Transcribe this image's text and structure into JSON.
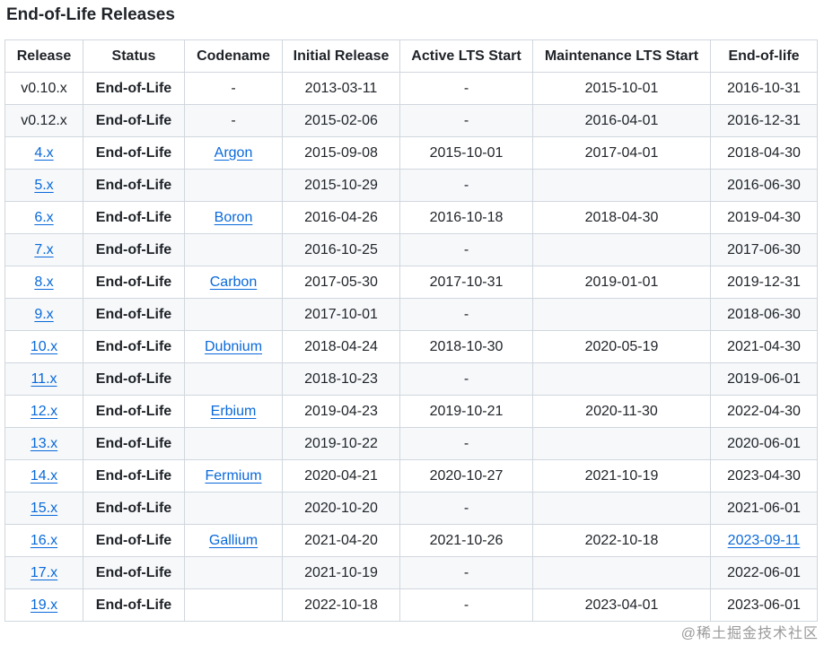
{
  "title": "End-of-Life Releases",
  "table": {
    "headers": [
      "Release",
      "Status",
      "Codename",
      "Initial Release",
      "Active LTS Start",
      "Maintenance LTS Start",
      "End-of-life"
    ],
    "rows": [
      {
        "release": "v0.10.x",
        "release_link": false,
        "status": "End-of-Life",
        "codename": "-",
        "codename_link": false,
        "initial": "2013-03-11",
        "active": "-",
        "maintenance": "2015-10-01",
        "eol": "2016-10-31",
        "eol_link": false
      },
      {
        "release": "v0.12.x",
        "release_link": false,
        "status": "End-of-Life",
        "codename": "-",
        "codename_link": false,
        "initial": "2015-02-06",
        "active": "-",
        "maintenance": "2016-04-01",
        "eol": "2016-12-31",
        "eol_link": false
      },
      {
        "release": "4.x",
        "release_link": true,
        "status": "End-of-Life",
        "codename": "Argon",
        "codename_link": true,
        "initial": "2015-09-08",
        "active": "2015-10-01",
        "maintenance": "2017-04-01",
        "eol": "2018-04-30",
        "eol_link": false
      },
      {
        "release": "5.x",
        "release_link": true,
        "status": "End-of-Life",
        "codename": "",
        "codename_link": false,
        "initial": "2015-10-29",
        "active": "-",
        "maintenance": "",
        "eol": "2016-06-30",
        "eol_link": false
      },
      {
        "release": "6.x",
        "release_link": true,
        "status": "End-of-Life",
        "codename": "Boron",
        "codename_link": true,
        "initial": "2016-04-26",
        "active": "2016-10-18",
        "maintenance": "2018-04-30",
        "eol": "2019-04-30",
        "eol_link": false
      },
      {
        "release": "7.x",
        "release_link": true,
        "status": "End-of-Life",
        "codename": "",
        "codename_link": false,
        "initial": "2016-10-25",
        "active": "-",
        "maintenance": "",
        "eol": "2017-06-30",
        "eol_link": false
      },
      {
        "release": "8.x",
        "release_link": true,
        "status": "End-of-Life",
        "codename": "Carbon",
        "codename_link": true,
        "initial": "2017-05-30",
        "active": "2017-10-31",
        "maintenance": "2019-01-01",
        "eol": "2019-12-31",
        "eol_link": false
      },
      {
        "release": "9.x",
        "release_link": true,
        "status": "End-of-Life",
        "codename": "",
        "codename_link": false,
        "initial": "2017-10-01",
        "active": "-",
        "maintenance": "",
        "eol": "2018-06-30",
        "eol_link": false
      },
      {
        "release": "10.x",
        "release_link": true,
        "status": "End-of-Life",
        "codename": "Dubnium",
        "codename_link": true,
        "initial": "2018-04-24",
        "active": "2018-10-30",
        "maintenance": "2020-05-19",
        "eol": "2021-04-30",
        "eol_link": false
      },
      {
        "release": "11.x",
        "release_link": true,
        "status": "End-of-Life",
        "codename": "",
        "codename_link": false,
        "initial": "2018-10-23",
        "active": "-",
        "maintenance": "",
        "eol": "2019-06-01",
        "eol_link": false
      },
      {
        "release": "12.x",
        "release_link": true,
        "status": "End-of-Life",
        "codename": "Erbium",
        "codename_link": true,
        "initial": "2019-04-23",
        "active": "2019-10-21",
        "maintenance": "2020-11-30",
        "eol": "2022-04-30",
        "eol_link": false
      },
      {
        "release": "13.x",
        "release_link": true,
        "status": "End-of-Life",
        "codename": "",
        "codename_link": false,
        "initial": "2019-10-22",
        "active": "-",
        "maintenance": "",
        "eol": "2020-06-01",
        "eol_link": false
      },
      {
        "release": "14.x",
        "release_link": true,
        "status": "End-of-Life",
        "codename": "Fermium",
        "codename_link": true,
        "initial": "2020-04-21",
        "active": "2020-10-27",
        "maintenance": "2021-10-19",
        "eol": "2023-04-30",
        "eol_link": false
      },
      {
        "release": "15.x",
        "release_link": true,
        "status": "End-of-Life",
        "codename": "",
        "codename_link": false,
        "initial": "2020-10-20",
        "active": "-",
        "maintenance": "",
        "eol": "2021-06-01",
        "eol_link": false
      },
      {
        "release": "16.x",
        "release_link": true,
        "status": "End-of-Life",
        "codename": "Gallium",
        "codename_link": true,
        "initial": "2021-04-20",
        "active": "2021-10-26",
        "maintenance": "2022-10-18",
        "eol": "2023-09-11",
        "eol_link": true
      },
      {
        "release": "17.x",
        "release_link": true,
        "status": "End-of-Life",
        "codename": "",
        "codename_link": false,
        "initial": "2021-10-19",
        "active": "-",
        "maintenance": "",
        "eol": "2022-06-01",
        "eol_link": false
      },
      {
        "release": "19.x",
        "release_link": true,
        "status": "End-of-Life",
        "codename": "",
        "codename_link": false,
        "initial": "2022-10-18",
        "active": "-",
        "maintenance": "2023-04-01",
        "eol": "2023-06-01",
        "eol_link": false
      }
    ]
  },
  "watermark": "@稀土掘金技术社区",
  "colors": {
    "link": "#0969da",
    "border": "#d0d7de",
    "stripe": "#f6f8fa",
    "text": "#1f2328"
  }
}
